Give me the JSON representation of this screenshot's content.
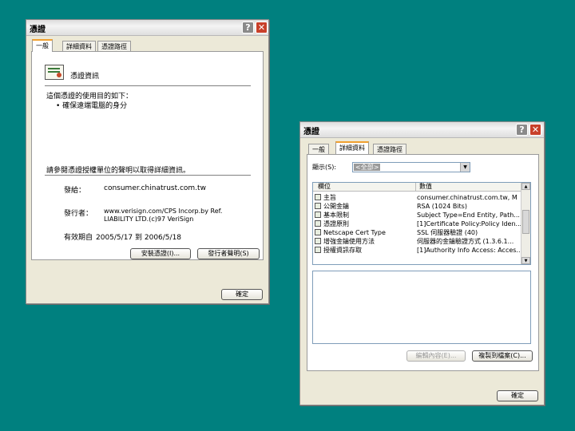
{
  "dialog_left": {
    "title": "憑證",
    "tabs": [
      "一般",
      "詳細資料",
      "憑證路徑"
    ],
    "header": "憑證資訊",
    "purpose_line": "這個憑證的使用目的如下：",
    "bullet": "• 確保遠端電腦的身分",
    "install_hint": "請參閱憑證授權單位的聲明以取得詳細資訊。",
    "issued_to_label": "發給：",
    "issued_to_value": "consumer.chinatrust.com.tw",
    "issuer_label": "發行者：",
    "issuer_value_1": "www.verisign.com/CPS Incorp.by Ref.",
    "issuer_value_2": "LIABILITY LTD.(c)97 VeriSign",
    "validity_label": "有效期自",
    "validity_value": "2005/5/17 到 2006/5/18",
    "install_button": "安裝憑證(I)...",
    "issuer_statement_button": "發行者聲明(S)",
    "ok_button": "確定"
  },
  "dialog_right": {
    "title": "憑證",
    "tabs": [
      "一般",
      "詳細資料",
      "憑證路徑"
    ],
    "show_label": "顯示(S):",
    "show_value": "<全部>",
    "columns": [
      "欄位",
      "數值"
    ],
    "rows": [
      {
        "field": "主旨",
        "value": "consumer.chinatrust.com.tw, M"
      },
      {
        "field": "公開金鑰",
        "value": "RSA (1024 Bits)"
      },
      {
        "field": "基本限制",
        "value": "Subject Type=End Entity, Path..."
      },
      {
        "field": "憑證原則",
        "value": "[1]Certificate Policy:Policy Iden..."
      },
      {
        "field": "Netscape Cert Type",
        "value": "SSL 伺服器驗證 (40)"
      },
      {
        "field": "增強金鑰使用方法",
        "value": "伺服器的金鑰驗證方式 (1.3.6.1..."
      },
      {
        "field": "授權資訊存取",
        "value": "[1]Authority Info Access: Acces..."
      }
    ],
    "edit_button": "編輯內容(E)...",
    "copy_button": "複製到檔案(C)...",
    "ok_button": "確定"
  },
  "colors": {
    "desktop": "#00807f",
    "dialog_face": "#ece9d8",
    "active_tab_accent": "#f0a030",
    "close_button": "#c8402a"
  }
}
